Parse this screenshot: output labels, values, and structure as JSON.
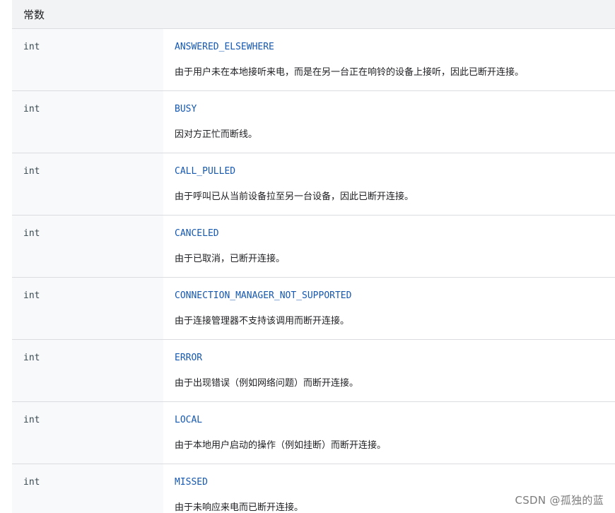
{
  "table": {
    "header": "常数",
    "rows": [
      {
        "type": "int",
        "name": "ANSWERED_ELSEWHERE",
        "description": "由于用户未在本地接听来电，而是在另一台正在响铃的设备上接听，因此已断开连接。"
      },
      {
        "type": "int",
        "name": "BUSY",
        "description": "因对方正忙而断线。"
      },
      {
        "type": "int",
        "name": "CALL_PULLED",
        "description": "由于呼叫已从当前设备拉至另一台设备，因此已断开连接。"
      },
      {
        "type": "int",
        "name": "CANCELED",
        "description": "由于已取消，已断开连接。"
      },
      {
        "type": "int",
        "name": "CONNECTION_MANAGER_NOT_SUPPORTED",
        "description": "由于连接管理器不支持该调用而断开连接。"
      },
      {
        "type": "int",
        "name": "ERROR",
        "description": "由于出现错误（例如网络问题）而断开连接。"
      },
      {
        "type": "int",
        "name": "LOCAL",
        "description": "由于本地用户启动的操作（例如挂断）而断开连接。"
      },
      {
        "type": "int",
        "name": "MISSED",
        "description": "由于未响应来电而已断开连接。"
      }
    ]
  },
  "watermark": "CSDN @孤独的蓝"
}
